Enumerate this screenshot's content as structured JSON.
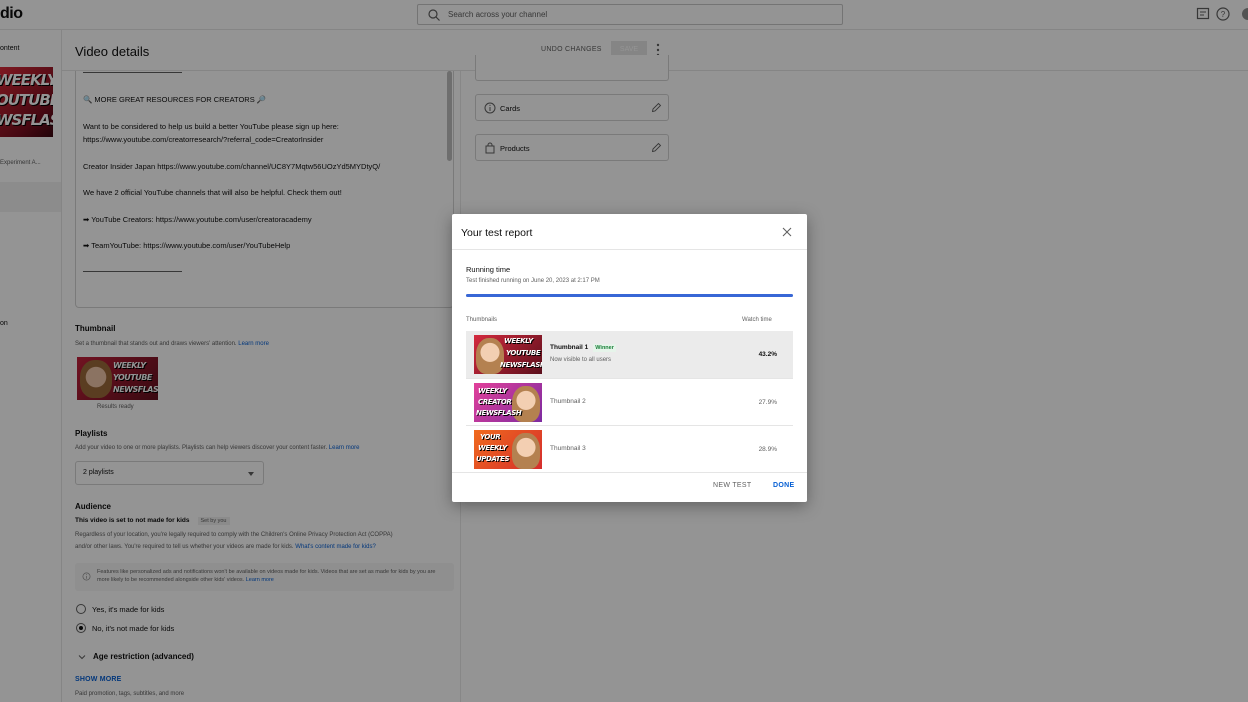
{
  "app": {
    "brand": "dio"
  },
  "search": {
    "placeholder": "Search across your channel"
  },
  "leftnav": {
    "label_top": "ontent",
    "thumb_text": [
      "WEEKLY",
      "OUTUBE",
      "WSFLASH"
    ],
    "caption": "Experiment A...",
    "label_mid": "on"
  },
  "header": {
    "title": "Video details",
    "undo_label": "UNDO CHANGES",
    "save_label": "SAVE"
  },
  "description": {
    "lines": [
      "🔍 MORE GREAT RESOURCES FOR CREATORS 🔎",
      "Want to be considered to help us build a better YouTube please sign up here:",
      "https://www.youtube.com/creatorresearch/?referral_code=CreatorInsider",
      "Creator Insider Japan https://www.youtube.com/channel/UC8Y7Mqtw56UOzYd5MYDtyQ/",
      "We have 2 official YouTube channels that will also be helpful. Check them out!",
      "➡ YouTube Creators: https://www.youtube.com/user/creatoracademy",
      "➡ TeamYouTube: https://www.youtube.com/user/YouTubeHelp"
    ]
  },
  "thumbnail_section": {
    "title": "Thumbnail",
    "help": "Set a thumbnail that stands out and draws viewers' attention.",
    "help_link": "Learn more",
    "thumb_text": [
      "WEEKLY",
      "YOUTUBE",
      "NEWSFLASH"
    ],
    "status": "Results ready"
  },
  "playlists": {
    "title": "Playlists",
    "help": "Add your video to one or more playlists. Playlists can help viewers discover your content faster.",
    "help_link": "Learn more",
    "selected": "2 playlists"
  },
  "audience": {
    "title": "Audience",
    "status": "This video is set to not made for kids",
    "status_badge": "Set by you",
    "help_1": "Regardless of your location, you're legally required to comply with the Children's Online Privacy Protection Act (COPPA)",
    "help_2": "and/or other laws. You're required to tell us whether your videos are made for kids.",
    "help_link": "What's content made for kids?",
    "info": "Features like personalized ads and notifications won't be available on videos made for kids. Videos that are set as made for kids by you are more likely to be recommended alongside other kids' videos.",
    "info_link": "Learn more",
    "option_yes": "Yes, it's made for kids",
    "option_no": "No, it's not made for kids",
    "selected": "no"
  },
  "age_restriction": {
    "label": "Age restriction (advanced)"
  },
  "show_more": {
    "label": "SHOW MORE",
    "sub": "Paid promotion, tags, subtitles, and more"
  },
  "sidebar": {
    "items": [
      {
        "label": "Cards",
        "icon": "info-icon"
      },
      {
        "label": "Products",
        "icon": "bag-icon"
      }
    ]
  },
  "dialog": {
    "title": "Your test report",
    "running_title": "Running time",
    "running_sub": "Test finished running on June 20, 2023 at 2:17 PM",
    "progress": 1.0,
    "col_thumbnails": "Thumbnails",
    "col_watch_time": "Watch time",
    "rows": [
      {
        "name": "Thumbnail 1",
        "badge": "Winner",
        "sub": "Now visible to all users",
        "value": "43.2%",
        "thumb_text": [
          "WEEKLY",
          "YOUTUBE",
          "NEWSFLASH"
        ]
      },
      {
        "name": "Thumbnail 2",
        "value": "27.9%",
        "thumb_text": [
          "WEEKLY",
          "CREATOR",
          "NEWSFLASH"
        ]
      },
      {
        "name": "Thumbnail 3",
        "value": "28.9%",
        "thumb_text": [
          "YOUR",
          "WEEKLY",
          "UPDATES"
        ]
      }
    ],
    "new_test_label": "NEW TEST",
    "done_label": "DONE"
  },
  "colors": {
    "accent": "#065fd4",
    "progress": "#3867d6",
    "winner_bg": "#e6f4ea",
    "winner_text": "#188038"
  }
}
